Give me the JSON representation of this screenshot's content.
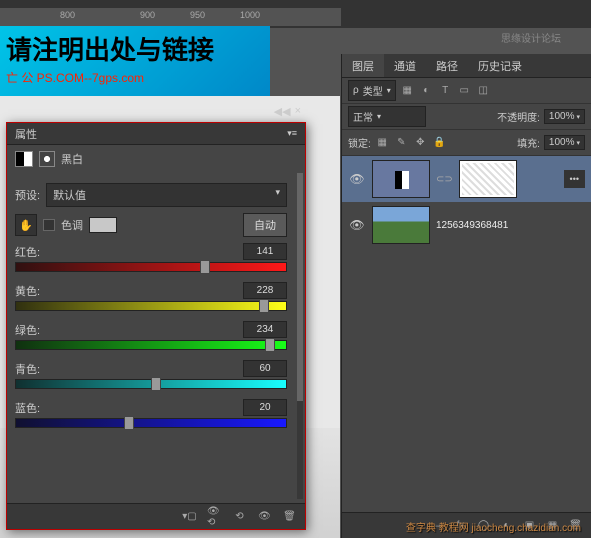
{
  "ruler": {
    "m800": "800",
    "m900": "900",
    "m950": "950",
    "m1000": "1000"
  },
  "topdesign": "思缘设计论坛",
  "banner": {
    "big": "请注明出处与链接",
    "sub": "亡 公 PS.COM--7gps.com"
  },
  "layers_panel": {
    "tabs": {
      "layers": "图层",
      "channels": "通道",
      "paths": "路径",
      "history": "历史记录"
    },
    "kind_label": "类型",
    "blend_mode": "正常",
    "opacity_label": "不透明度:",
    "opacity_val": "100%",
    "lock_label": "锁定:",
    "fill_label": "填充:",
    "fill_val": "100%",
    "layer2_name": "1256349368481"
  },
  "properties": {
    "panel_title": "属性",
    "adj_name": "黑白",
    "preset_label": "预设:",
    "preset_value": "默认值",
    "tint_label": "色调",
    "auto_btn": "自动",
    "sliders": {
      "red": {
        "label": "红色:",
        "value": "141"
      },
      "yellow": {
        "label": "黄色:",
        "value": "228"
      },
      "green": {
        "label": "绿色:",
        "value": "234"
      },
      "cyan": {
        "label": "青色:",
        "value": "60"
      },
      "blue": {
        "label": "蓝色:",
        "value": "20"
      }
    }
  },
  "watermark": "查字典 教程网  jiaocheng.chazidian.com"
}
